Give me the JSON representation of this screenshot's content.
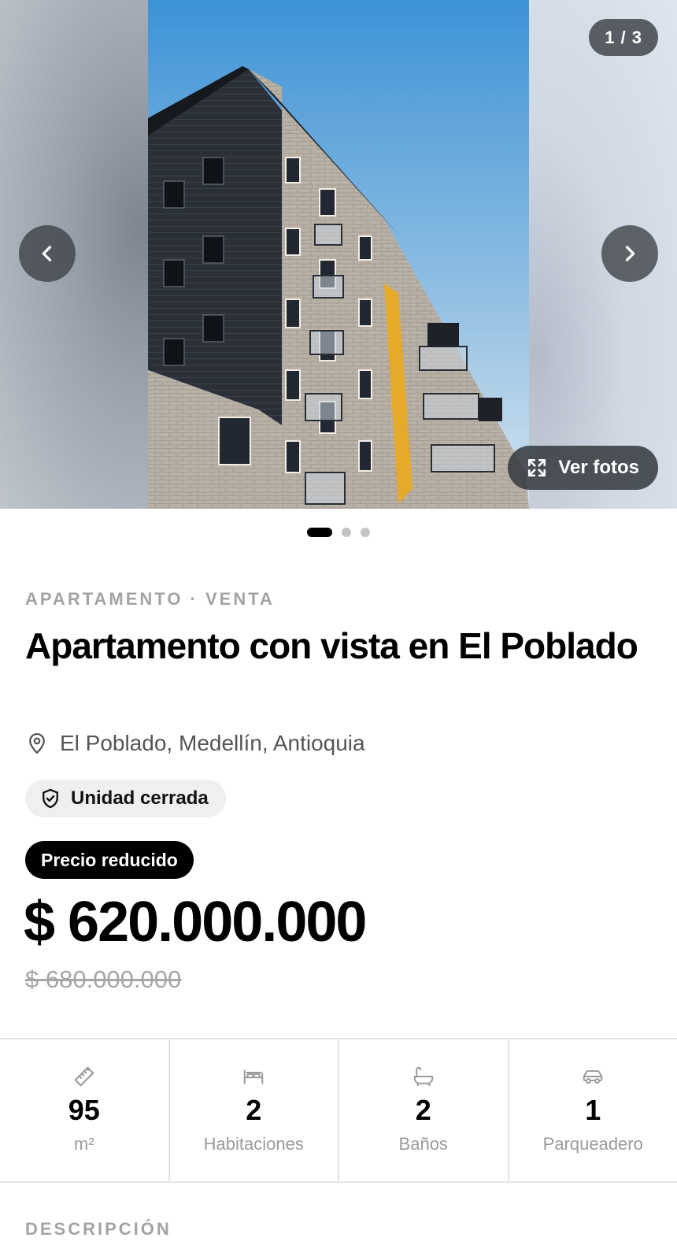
{
  "gallery": {
    "counter": "1 / 3",
    "view_photos_label": "Ver fotos",
    "total_photos": 3,
    "active_index": 1
  },
  "listing": {
    "eyebrow": "APARTAMENTO · VENTA",
    "title": "Apartamento con vista en El Poblado",
    "location": "El Poblado, Medellín, Antioquia",
    "feature_chip": "Unidad cerrada",
    "price_badge": "Precio reducido",
    "price": "$ 620.000.000",
    "old_price": "$ 680.000.000"
  },
  "stats": [
    {
      "icon": "ruler-icon",
      "value": "95",
      "label": "m²"
    },
    {
      "icon": "bed-icon",
      "value": "2",
      "label": "Habitaciones"
    },
    {
      "icon": "bathtub-icon",
      "value": "2",
      "label": "Baños"
    },
    {
      "icon": "car-icon",
      "value": "1",
      "label": "Parqueadero"
    }
  ],
  "description": {
    "heading": "DESCRIPCIÓN"
  }
}
